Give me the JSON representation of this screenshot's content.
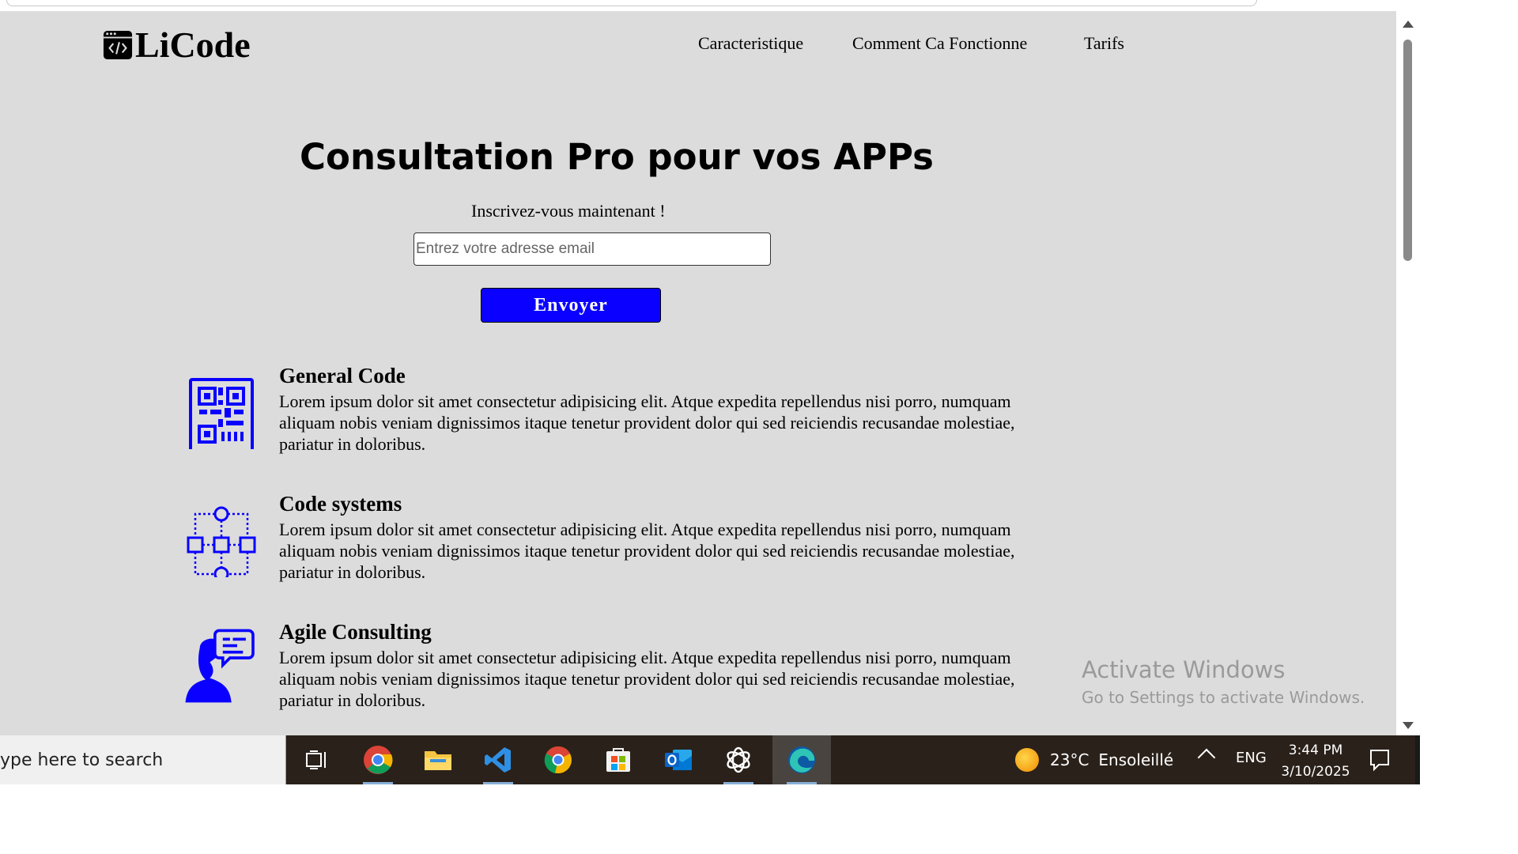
{
  "header": {
    "logo_text": "LiCode",
    "nav": [
      "Caracteristique",
      "Comment Ca Fonctionne",
      "Tarifs"
    ]
  },
  "hero": {
    "title": "Consultation Pro pour vos APPs",
    "subtitle": "Inscrivez-vous maintenant !",
    "email_placeholder": "Entrez votre adresse email",
    "submit_label": "Envoyer"
  },
  "features": [
    {
      "title": "General Code",
      "icon": "qr-code-icon",
      "description": "Lorem ipsum dolor sit amet consectetur adipisicing elit. Atque expedita repellendus nisi porro, numquam aliquam nobis veniam dignissimos itaque tenetur provident dolor qui sed reiciendis recusandae molestiae, pariatur in doloribus."
    },
    {
      "title": "Code systems",
      "icon": "flowchart-icon",
      "description": "Lorem ipsum dolor sit amet consectetur adipisicing elit. Atque expedita repellendus nisi porro, numquam aliquam nobis veniam dignissimos itaque tenetur provident dolor qui sed reiciendis recusandae molestiae, pariatur in doloribus."
    },
    {
      "title": "Agile Consulting",
      "icon": "consultant-chat-icon",
      "description": "Lorem ipsum dolor sit amet consectetur adipisicing elit. Atque expedita repellendus nisi porro, numquam aliquam nobis veniam dignissimos itaque tenetur provident dolor qui sed reiciendis recusandae molestiae, pariatur in doloribus."
    }
  ],
  "watermark": {
    "line1": "Activate Windows",
    "line2": "Go to Settings to activate Windows."
  },
  "taskbar": {
    "search_placeholder": "ype here to search",
    "apps": [
      "task-view-icon",
      "chrome-icon",
      "file-explorer-icon",
      "vscode-icon",
      "chrome-alt-icon",
      "ms-store-icon",
      "outlook-icon",
      "chatgpt-icon",
      "edge-icon"
    ],
    "weather_temp": "23°C",
    "weather_text": "Ensoleillé",
    "language": "ENG",
    "time": "3:44 PM",
    "date": "3/10/2025"
  },
  "colors": {
    "page_background": "#dcdcdc",
    "accent_blue": "#0a00ff",
    "taskbar": "#2a211a"
  }
}
